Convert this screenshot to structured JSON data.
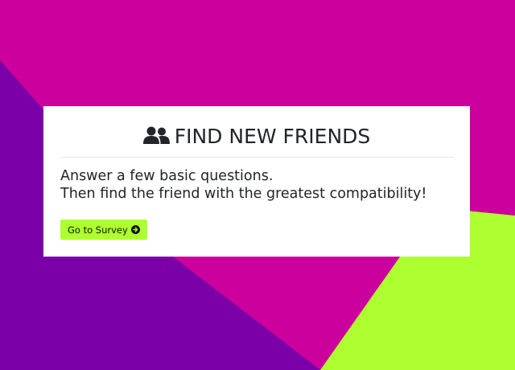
{
  "colors": {
    "magenta": "#cc009c",
    "purple": "#7b00a8",
    "lime": "#adff2f",
    "card": "#ffffff",
    "text": "#212529"
  },
  "header": {
    "icon": "users-icon",
    "title": "FIND NEW FRIENDS"
  },
  "main": {
    "line1": "Answer a few basic questions.",
    "line2": "Then find the friend with the greatest compatibility!"
  },
  "actions": {
    "survey_label": "Go to Survey",
    "survey_icon": "arrow-circle-right-icon"
  }
}
